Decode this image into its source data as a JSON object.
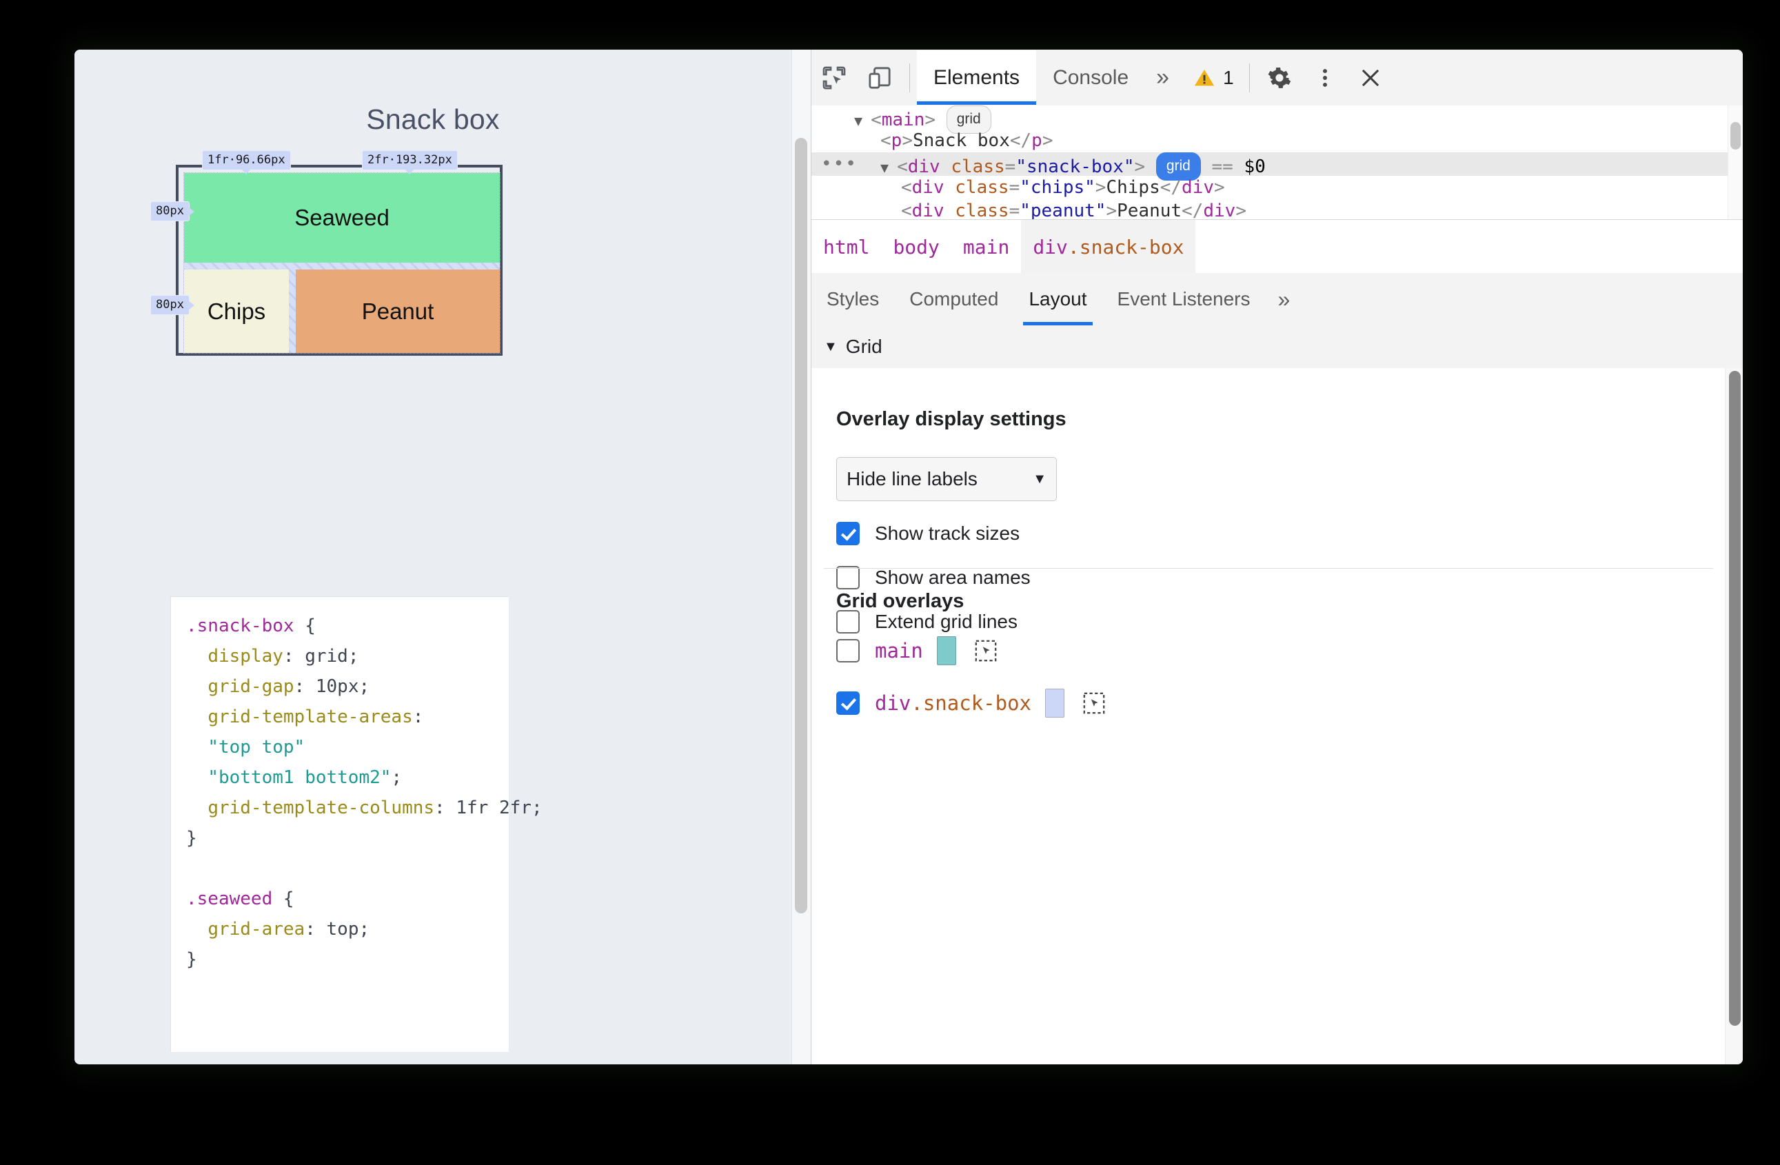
{
  "page": {
    "title": "Snack box",
    "grid": {
      "cells": [
        {
          "name": "Seaweed",
          "color": "#79e8a9"
        },
        {
          "name": "Chips",
          "color": "#f3f3dd"
        },
        {
          "name": "Peanut",
          "color": "#e8a877"
        }
      ],
      "track_labels": {
        "col1": "1fr·96.66px",
        "col2": "2fr·193.32px",
        "row1": "80px",
        "row2": "80px"
      }
    },
    "code": {
      "lines": [
        [
          {
            "t": "sel",
            "v": ".snack-box"
          },
          {
            "t": "pun",
            "v": " {"
          }
        ],
        [
          {
            "t": "pun",
            "v": "  "
          },
          {
            "t": "prop",
            "v": "display"
          },
          {
            "t": "pun",
            "v": ": "
          },
          {
            "t": "val",
            "v": "grid"
          },
          {
            "t": "pun",
            "v": ";"
          }
        ],
        [
          {
            "t": "pun",
            "v": "  "
          },
          {
            "t": "prop",
            "v": "grid-gap"
          },
          {
            "t": "pun",
            "v": ": "
          },
          {
            "t": "val",
            "v": "10px"
          },
          {
            "t": "pun",
            "v": ";"
          }
        ],
        [
          {
            "t": "pun",
            "v": "  "
          },
          {
            "t": "prop",
            "v": "grid-template-areas"
          },
          {
            "t": "pun",
            "v": ":"
          }
        ],
        [
          {
            "t": "pun",
            "v": "  "
          },
          {
            "t": "str",
            "v": "\"top top\""
          }
        ],
        [
          {
            "t": "pun",
            "v": "  "
          },
          {
            "t": "str",
            "v": "\"bottom1 bottom2\""
          },
          {
            "t": "pun",
            "v": ";"
          }
        ],
        [
          {
            "t": "pun",
            "v": "  "
          },
          {
            "t": "prop",
            "v": "grid-template-columns"
          },
          {
            "t": "pun",
            "v": ": "
          },
          {
            "t": "val",
            "v": "1fr 2fr"
          },
          {
            "t": "pun",
            "v": ";"
          }
        ],
        [
          {
            "t": "pun",
            "v": "}"
          }
        ],
        [
          {
            "t": "pun",
            "v": ""
          }
        ],
        [
          {
            "t": "sel",
            "v": ".seaweed"
          },
          {
            "t": "pun",
            "v": " {"
          }
        ],
        [
          {
            "t": "pun",
            "v": "  "
          },
          {
            "t": "prop",
            "v": "grid-area"
          },
          {
            "t": "pun",
            "v": ": "
          },
          {
            "t": "val",
            "v": "top"
          },
          {
            "t": "pun",
            "v": ";"
          }
        ],
        [
          {
            "t": "pun",
            "v": "}"
          }
        ]
      ]
    }
  },
  "devtools": {
    "toolbar": {
      "inspect_icon": "inspect-element-icon",
      "device_icon": "device-toolbar-icon",
      "tabs": [
        {
          "label": "Elements",
          "active": true
        },
        {
          "label": "Console",
          "active": false
        }
      ],
      "more_tabs": "»",
      "warning_count": "1",
      "settings_icon": "gear-icon",
      "menu_icon": "kebab-menu-icon",
      "close_icon": "close-icon"
    },
    "dom_tree": {
      "rows": [
        {
          "indent": 1,
          "triangle": "▼",
          "selected": false,
          "ellipsis": false,
          "parts": [
            {
              "t": "punc",
              "v": "<"
            },
            {
              "t": "tag",
              "v": "main"
            },
            {
              "t": "punc",
              "v": ">"
            },
            {
              "t": "badge",
              "v": "grid",
              "on": false
            }
          ]
        },
        {
          "indent": 2,
          "triangle": "",
          "selected": false,
          "ellipsis": false,
          "parts": [
            {
              "t": "punc",
              "v": "<"
            },
            {
              "t": "tag",
              "v": "p"
            },
            {
              "t": "punc",
              "v": ">"
            },
            {
              "t": "txt",
              "v": "Snack box"
            },
            {
              "t": "punc",
              "v": "</"
            },
            {
              "t": "tag",
              "v": "p"
            },
            {
              "t": "punc",
              "v": ">"
            }
          ]
        },
        {
          "indent": 2,
          "triangle": "▼",
          "selected": true,
          "ellipsis": true,
          "parts": [
            {
              "t": "punc",
              "v": "<"
            },
            {
              "t": "tag",
              "v": "div"
            },
            {
              "t": "punc",
              "v": " "
            },
            {
              "t": "attr",
              "v": "class"
            },
            {
              "t": "punc",
              "v": "="
            },
            {
              "t": "str",
              "v": "\"snack-box\""
            },
            {
              "t": "punc",
              "v": ">"
            },
            {
              "t": "badge",
              "v": "grid",
              "on": true
            },
            {
              "t": "punc",
              "v": " == "
            },
            {
              "t": "dollar",
              "v": "$0"
            }
          ]
        },
        {
          "indent": 3,
          "triangle": "",
          "selected": false,
          "ellipsis": false,
          "parts": [
            {
              "t": "punc",
              "v": "<"
            },
            {
              "t": "tag",
              "v": "div"
            },
            {
              "t": "punc",
              "v": " "
            },
            {
              "t": "attr",
              "v": "class"
            },
            {
              "t": "punc",
              "v": "="
            },
            {
              "t": "str",
              "v": "\"chips\""
            },
            {
              "t": "punc",
              "v": ">"
            },
            {
              "t": "txt",
              "v": "Chips"
            },
            {
              "t": "punc",
              "v": "</"
            },
            {
              "t": "tag",
              "v": "div"
            },
            {
              "t": "punc",
              "v": ">"
            }
          ]
        },
        {
          "indent": 3,
          "triangle": "",
          "selected": false,
          "ellipsis": false,
          "parts": [
            {
              "t": "punc",
              "v": "<"
            },
            {
              "t": "tag",
              "v": "div"
            },
            {
              "t": "punc",
              "v": " "
            },
            {
              "t": "attr",
              "v": "class"
            },
            {
              "t": "punc",
              "v": "="
            },
            {
              "t": "str",
              "v": "\"peanut\""
            },
            {
              "t": "punc",
              "v": ">"
            },
            {
              "t": "txt",
              "v": "Peanut"
            },
            {
              "t": "punc",
              "v": "</"
            },
            {
              "t": "tag",
              "v": "div"
            },
            {
              "t": "punc",
              "v": ">"
            }
          ]
        }
      ]
    },
    "breadcrumb": [
      {
        "label": "html",
        "cls": "",
        "selected": false
      },
      {
        "label": "body",
        "cls": "",
        "selected": false
      },
      {
        "label": "main",
        "cls": "",
        "selected": false
      },
      {
        "label": "div",
        "cls": ".snack-box",
        "selected": true
      }
    ],
    "subtabs": [
      {
        "label": "Styles",
        "active": false
      },
      {
        "label": "Computed",
        "active": false
      },
      {
        "label": "Layout",
        "active": true
      },
      {
        "label": "Event Listeners",
        "active": false
      }
    ],
    "subtabs_more": "»",
    "grid_section": {
      "caret": "▼",
      "title": "Grid",
      "overlay_settings_title": "Overlay display settings",
      "line_labels_value": "Hide line labels",
      "dropdown_caret": "▼",
      "checkboxes": [
        {
          "label": "Show track sizes",
          "checked": true
        },
        {
          "label": "Show area names",
          "checked": false
        },
        {
          "label": "Extend grid lines",
          "checked": false
        }
      ],
      "overlays_title": "Grid overlays",
      "overlays": [
        {
          "name": "main",
          "cls": "",
          "checked": false,
          "color": "#7fcbcb"
        },
        {
          "name": "div",
          "cls": ".snack-box",
          "checked": true,
          "color": "#ccd6f6"
        }
      ]
    }
  },
  "colors": {
    "accent": "#1a73e8",
    "page_bg": "#eaeef3",
    "warning": "#f2b31a"
  }
}
